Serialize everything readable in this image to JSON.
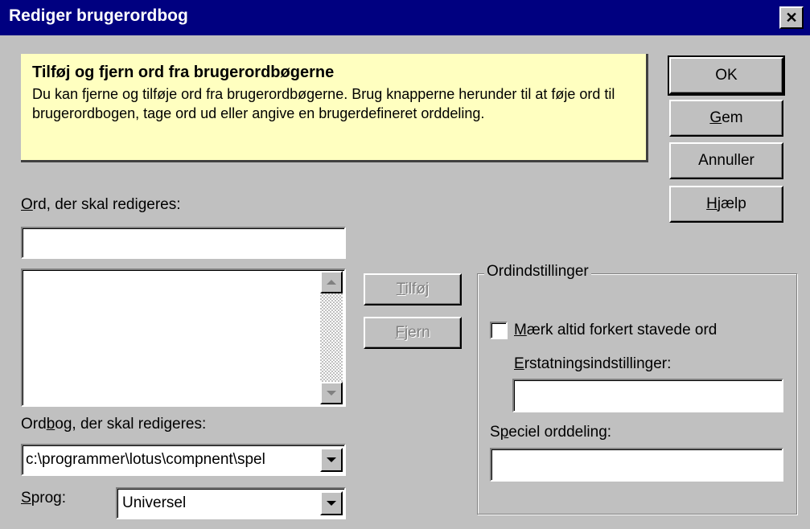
{
  "window": {
    "title": "Rediger brugerordbog",
    "close_glyph": "✕"
  },
  "info": {
    "heading": "Tilføj og fjern ord fra brugerordbøgerne",
    "text": "Du kan fjerne og tilføje ord fra brugerordbøgerne. Brug knapperne herunder til at føje ord til brugerordbogen, tage ord ud eller angive en brugerdefineret orddeling."
  },
  "buttons": {
    "ok": "OK",
    "gem_u": "G",
    "gem_rest": "em",
    "annuller": "Annuller",
    "hjaelp_u": "H",
    "hjaelp_rest": "jælp",
    "tilfoej_u": "T",
    "tilfoej_rest": "ilføj",
    "fjern_u": "F",
    "fjern_rest": "jern"
  },
  "word_field": {
    "label_u": "O",
    "label_rest": "rd, der skal redigeres:",
    "value": ""
  },
  "word_list": {
    "items": []
  },
  "dictionary": {
    "label_pre": "Ord",
    "label_u": "b",
    "label_rest": "og, der skal redigeres:",
    "value": "c:\\programmer\\lotus\\compnent\\spel"
  },
  "language": {
    "label_u": "S",
    "label_rest": "prog:",
    "value": "Universel"
  },
  "word_settings": {
    "group_label": "Ordindstillinger",
    "checkbox_u": "M",
    "checkbox_rest": "ærk altid forkert stavede ord",
    "checkbox_checked": false,
    "replacement_label_u": "E",
    "replacement_label_rest": "rstatningsindstillinger:",
    "replacement_value": "",
    "hyphenation_label_pre": "S",
    "hyphenation_label_u": "p",
    "hyphenation_label_rest": "eciel orddeling:",
    "hyphenation_value": ""
  }
}
